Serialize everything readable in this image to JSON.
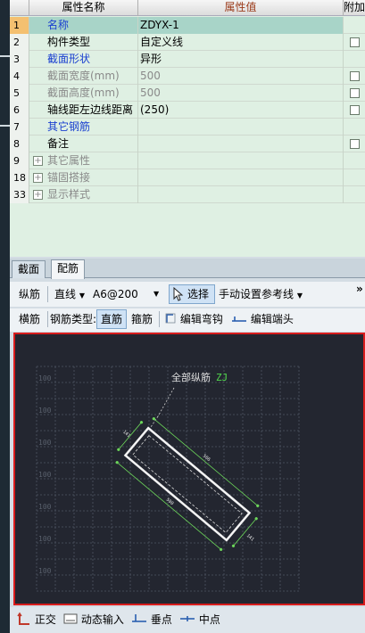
{
  "grid": {
    "header": {
      "name": "属性名称",
      "value": "属性值",
      "add": "附加"
    },
    "rows": [
      {
        "num": "1",
        "name": "名称",
        "value": "ZDYX-1",
        "check": false
      },
      {
        "num": "2",
        "name": "构件类型",
        "value": "自定义线",
        "check": true
      },
      {
        "num": "3",
        "name": "截面形状",
        "value": "异形",
        "check": false
      },
      {
        "num": "4",
        "name": "截面宽度(mm)",
        "value": "500",
        "check": true
      },
      {
        "num": "5",
        "name": "截面高度(mm)",
        "value": "500",
        "check": true
      },
      {
        "num": "6",
        "name": "轴线距左边线距离",
        "value": "(250)",
        "check": true
      },
      {
        "num": "7",
        "name": "其它钢筋",
        "value": "",
        "check": false
      },
      {
        "num": "8",
        "name": "备注",
        "value": "",
        "check": true
      },
      {
        "num": "9",
        "name": "其它属性",
        "value": "",
        "check": false
      },
      {
        "num": "18",
        "name": "锚固搭接",
        "value": "",
        "check": false
      },
      {
        "num": "33",
        "name": "显示样式",
        "value": "",
        "check": false
      }
    ]
  },
  "tabs": {
    "section": "截面",
    "rebar": "配筋"
  },
  "toolbar1": {
    "label_long": "纵筋",
    "line_type": "直线",
    "rebar_spec": "A6@200",
    "select_label": "选择",
    "manual_ref": "手动设置参考线",
    "more": "»"
  },
  "toolbar2": {
    "horizontal": "横筋",
    "type_label": "钢筋类型:",
    "straight": "直筋",
    "stirrup": "箍筋",
    "edit_hook": "编辑弯钩",
    "edit_end": "编辑端头"
  },
  "canvas": {
    "callout": "全部纵筋",
    "callout_tag": "ZJ",
    "axis_label": "100",
    "dim_small": "141",
    "dim_long": "566",
    "dim_inner": "500"
  },
  "bottombar": {
    "ortho": "正交",
    "dynamic": "动态输入",
    "perp": "垂点",
    "mid": "中点"
  },
  "colors": {
    "selected_row": "#a8d4c8",
    "canvas_border": "#d81c1c",
    "canvas_bg": "#232630"
  }
}
